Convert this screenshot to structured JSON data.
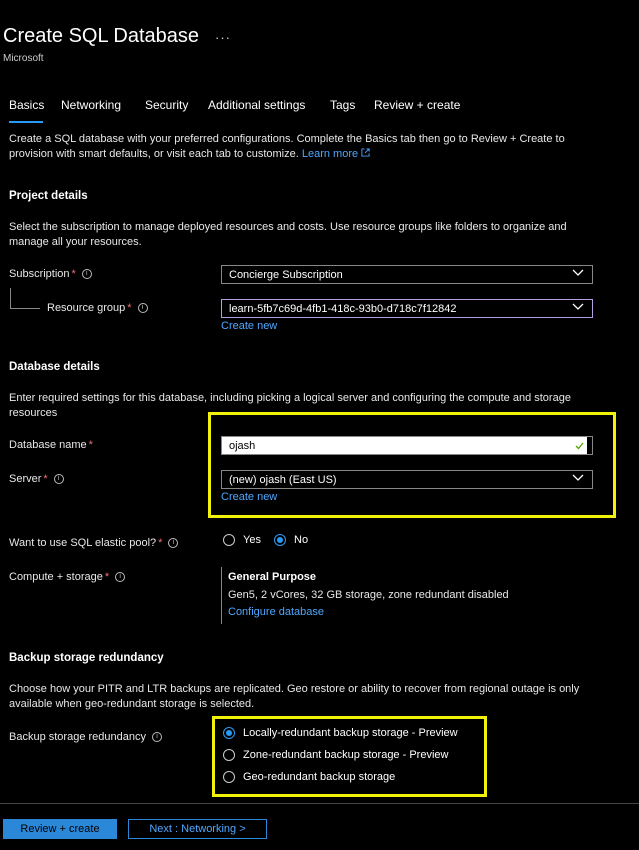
{
  "header": {
    "title": "Create SQL Database",
    "ellipsis": "···",
    "subtitle": "Microsoft"
  },
  "tabs": [
    {
      "label": "Basics",
      "active": true
    },
    {
      "label": "Networking"
    },
    {
      "label": "Security"
    },
    {
      "label": "Additional settings"
    },
    {
      "label": "Tags"
    },
    {
      "label": "Review + create"
    }
  ],
  "intro": {
    "text": "Create a SQL database with your preferred configurations. Complete the Basics tab then go to Review + Create to provision with smart defaults, or visit each tab to customize.",
    "learn_more": "Learn more"
  },
  "project": {
    "heading": "Project details",
    "description": "Select the subscription to manage deployed resources and costs. Use resource groups like folders to organize and manage all your resources.",
    "subscription_label": "Subscription",
    "subscription_value": "Concierge Subscription",
    "rg_label": "Resource group",
    "rg_value": "learn-5fb7c69d-4fb1-418c-93b0-d718c7f12842",
    "rg_create_new": "Create new"
  },
  "database": {
    "heading": "Database details",
    "description": "Enter required settings for this database, including picking a logical server and configuring the compute and storage resources",
    "name_label": "Database name",
    "name_value": "ojash",
    "server_label": "Server",
    "server_value": "(new) ojash (East US)",
    "server_create_new": "Create new",
    "elastic_label": "Want to use SQL elastic pool?",
    "elastic_yes": "Yes",
    "elastic_no": "No",
    "elastic_selected": "No",
    "compute_label": "Compute + storage",
    "compute_tier": "General Purpose",
    "compute_detail": "Gen5, 2 vCores, 32 GB storage, zone redundant disabled",
    "compute_configure": "Configure database"
  },
  "backup": {
    "heading": "Backup storage redundancy",
    "description": "Choose how your PITR and LTR backups are replicated. Geo restore or ability to recover from regional outage is only available when geo-redundant storage is selected.",
    "label": "Backup storage redundancy",
    "options": [
      {
        "label": "Locally-redundant backup storage - Preview",
        "selected": true
      },
      {
        "label": "Zone-redundant backup storage - Preview",
        "selected": false
      },
      {
        "label": "Geo-redundant backup storage",
        "selected": false
      }
    ]
  },
  "footer": {
    "review_create": "Review + create",
    "next": "Next : Networking >"
  },
  "colors": {
    "accent": "#2899f5",
    "highlight": "#f1f10a",
    "required": "#f1707b"
  }
}
